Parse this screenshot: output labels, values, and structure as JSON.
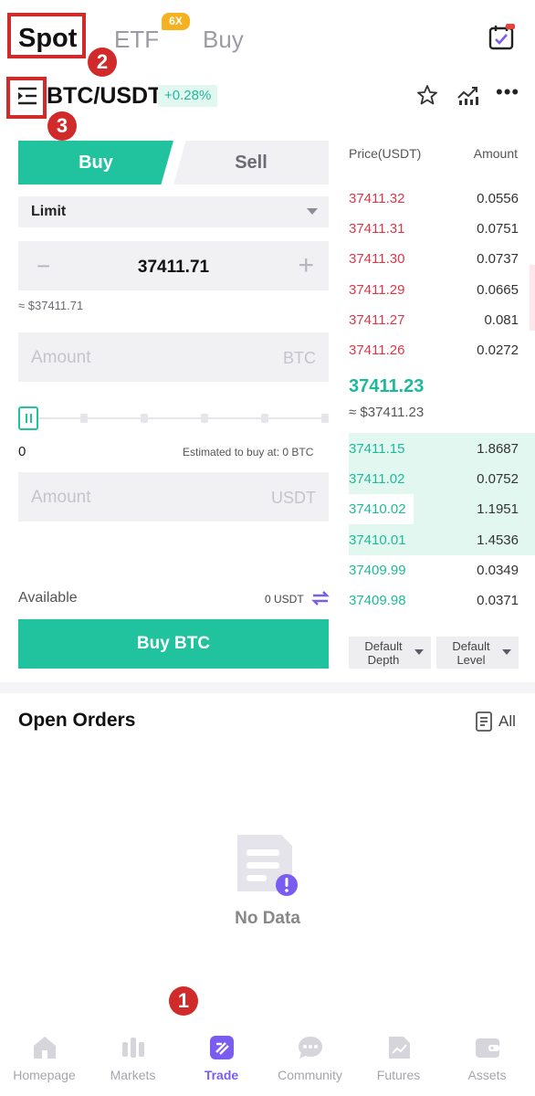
{
  "header": {
    "tabs": [
      "Spot",
      "ETF",
      "Buy"
    ],
    "etf_badge": "6X",
    "pair": "BTC/USDT",
    "change": "+0.28%"
  },
  "annotations": [
    "1",
    "2",
    "3"
  ],
  "form": {
    "buy_tab": "Buy",
    "sell_tab": "Sell",
    "order_type": "Limit",
    "price_value": "37411.71",
    "price_minus": "−",
    "price_plus": "+",
    "price_usd": "≈ $37411.71",
    "amount_placeholder": "Amount",
    "amount_unit_btc": "BTC",
    "amount_unit_usdt": "USDT",
    "slider_value": "0",
    "estimated": "Estimated to buy at: 0 BTC",
    "available_label": "Available",
    "available_value": "0 USDT",
    "buy_button": "Buy BTC"
  },
  "orderbook": {
    "price_header": "Price(USDT)",
    "amount_header": "Amount",
    "asks": [
      {
        "price": "37411.32",
        "amount": "0.0556"
      },
      {
        "price": "37411.31",
        "amount": "0.0751"
      },
      {
        "price": "37411.30",
        "amount": "0.0737"
      },
      {
        "price": "37411.29",
        "amount": "0.0665"
      },
      {
        "price": "37411.27",
        "amount": "0.081"
      },
      {
        "price": "37411.26",
        "amount": "0.0272"
      }
    ],
    "last_price": "37411.23",
    "last_price_usd": "≈ $37411.23",
    "bids": [
      {
        "price": "37411.15",
        "amount": "1.8687",
        "depth": 1.0
      },
      {
        "price": "37411.02",
        "amount": "0.0752",
        "depth": 1.0
      },
      {
        "price": "37410.02",
        "amount": "1.1951",
        "depth": 0.65
      },
      {
        "price": "37410.01",
        "amount": "1.4536",
        "depth": 1.0
      },
      {
        "price": "37409.99",
        "amount": "0.0349",
        "depth": 0
      },
      {
        "price": "37409.98",
        "amount": "0.0371",
        "depth": 0
      }
    ],
    "depth_button": [
      "Default",
      "Depth"
    ],
    "level_button": [
      "Default",
      "Level"
    ]
  },
  "open_orders": {
    "title": "Open Orders",
    "all_label": "All",
    "empty_text": "No Data"
  },
  "bottom_nav": [
    {
      "label": "Homepage",
      "icon": "home-icon"
    },
    {
      "label": "Markets",
      "icon": "markets-icon"
    },
    {
      "label": "Trade",
      "icon": "trade-icon",
      "active": true
    },
    {
      "label": "Community",
      "icon": "community-icon"
    },
    {
      "label": "Futures",
      "icon": "futures-icon"
    },
    {
      "label": "Assets",
      "icon": "assets-icon"
    }
  ],
  "colors": {
    "accent_green": "#21c29e",
    "ask_red": "#d8394a",
    "annotation_red": "#d12a2a",
    "nav_active": "#7b5cf0"
  }
}
